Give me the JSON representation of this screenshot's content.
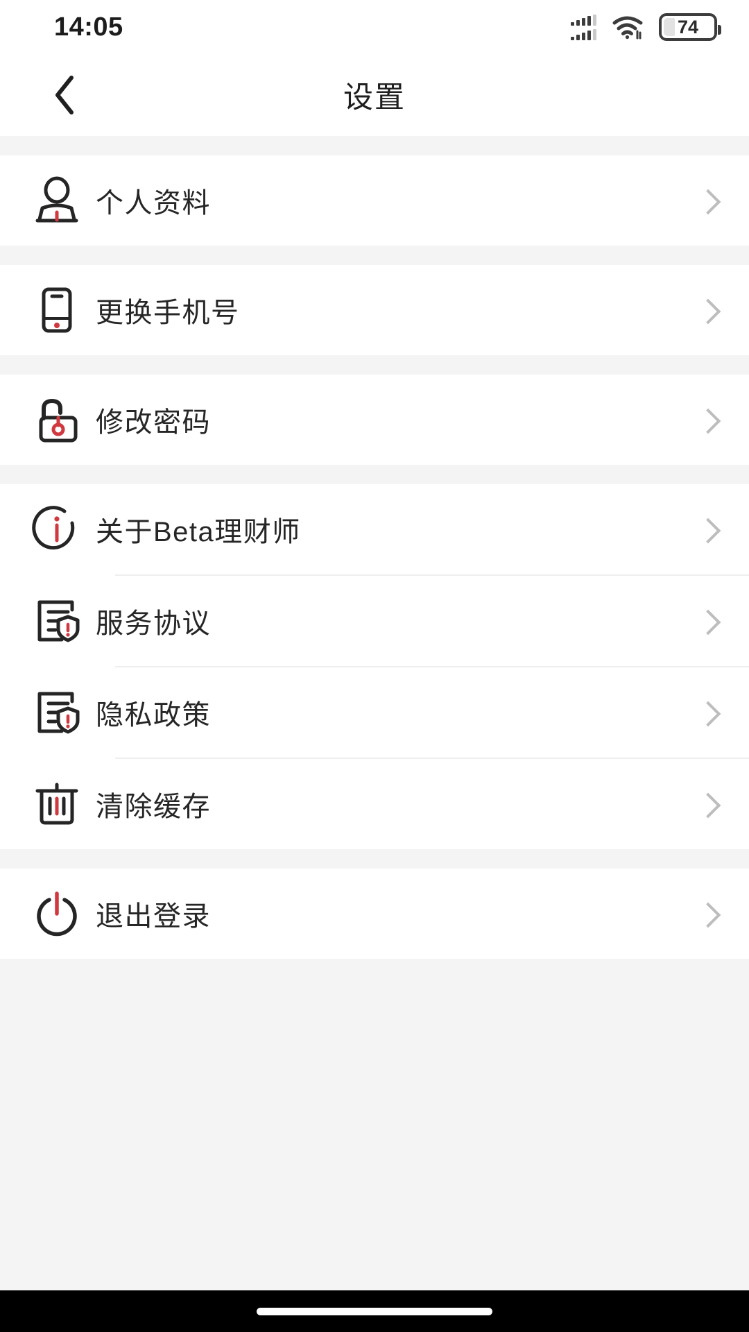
{
  "status_bar": {
    "time": "14:05",
    "battery_level": "74",
    "signal_icon": "cellular-signal-icon",
    "wifi_icon": "wifi-icon",
    "battery_icon": "battery-icon"
  },
  "nav": {
    "title": "设置",
    "back_icon": "chevron-left-icon"
  },
  "theme": {
    "accent": "#d0393f",
    "ink": "#262626",
    "page_bg": "#f4f4f4",
    "card_bg": "#ffffff",
    "chevron": "#bdbdbd",
    "divider": "#eeeeee"
  },
  "groups": [
    {
      "items": [
        {
          "label": "个人资料",
          "icon": "user-profile-icon",
          "chevron": "chevron-right-icon"
        }
      ]
    },
    {
      "items": [
        {
          "label": "更换手机号",
          "icon": "mobile-phone-icon",
          "chevron": "chevron-right-icon"
        }
      ]
    },
    {
      "items": [
        {
          "label": "修改密码",
          "icon": "unlock-padlock-icon",
          "chevron": "chevron-right-icon"
        }
      ]
    },
    {
      "items": [
        {
          "label": "关于Beta理财师",
          "icon": "info-circle-icon",
          "chevron": "chevron-right-icon"
        },
        {
          "label": "服务协议",
          "icon": "document-shield-icon",
          "chevron": "chevron-right-icon"
        },
        {
          "label": "隐私政策",
          "icon": "document-shield-icon",
          "chevron": "chevron-right-icon"
        },
        {
          "label": "清除缓存",
          "icon": "trash-can-icon",
          "chevron": "chevron-right-icon"
        }
      ]
    },
    {
      "items": [
        {
          "label": "退出登录",
          "icon": "power-off-icon",
          "chevron": "chevron-right-icon"
        }
      ]
    }
  ]
}
